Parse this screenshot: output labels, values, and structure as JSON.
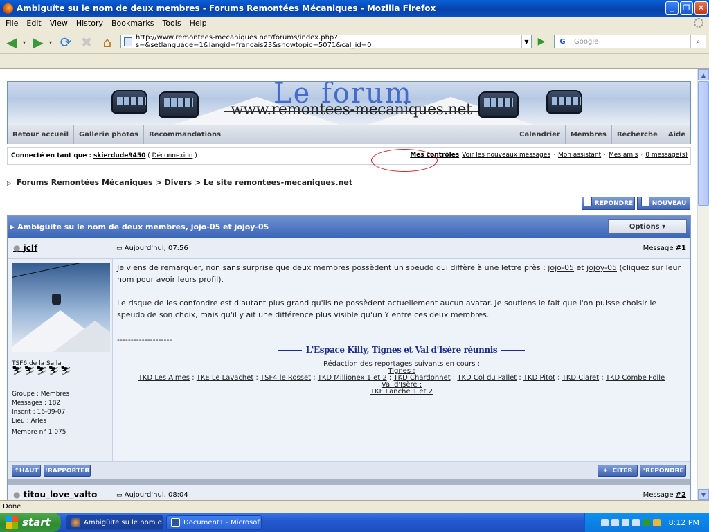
{
  "window": {
    "title": "Ambiguïte su le nom de deux membres - Forums Remontées Mécaniques - Mozilla Firefox"
  },
  "menu": [
    "File",
    "Edit",
    "View",
    "History",
    "Bookmarks",
    "Tools",
    "Help"
  ],
  "nav": {
    "url": "http://www.remontees-mecaniques.net/forums/index.php?s=&setlanguage=1&langid=francais23&showtopic=5071&cal_id=0",
    "search_engine": "G",
    "search_placeholder": "Google"
  },
  "banner": {
    "title": "Le forum",
    "site": "www.remontees-mecaniques.net"
  },
  "topnav": {
    "left": [
      "Retour accueil",
      "Gallerie photos",
      "Recommandations"
    ],
    "right": [
      "Calendrier",
      "Membres",
      "Recherche",
      "Aide"
    ]
  },
  "userbar": {
    "prefix": "Connecté en tant que :",
    "username": "skierdude9450",
    "logout": "Déconnexion",
    "links": [
      "Mes contrôles",
      "Voir les nouveaux messages",
      "Mon assistant",
      "Mes amis",
      "0 message(s)"
    ]
  },
  "breadcrumb": [
    "Forums Remontées Mécaniques",
    "Divers",
    "Le site remontees-mecaniques.net"
  ],
  "actions": {
    "reply": "REPONDRE",
    "new": "NOUVEAU"
  },
  "thread": {
    "title": "Ambigüite su le nom de deux membres, jojo-05 et jojoy-05",
    "options": "Options"
  },
  "post1": {
    "author": "jclf",
    "date": "Aujourd'hui, 07:56",
    "message_label": "Message",
    "message_num": "#1",
    "rank": "TSF6 de la Salla",
    "stats": [
      "Groupe : Membres",
      "Messages : 182",
      "Inscrit : 16-09-07",
      "Lieu : Arles",
      "Membre n° 1 075"
    ],
    "para1_a": "Je viens de remarquer, non sans surprise que deux membres possèdent un speudo qui diffère à une lettre près : ",
    "link1": "jojo-05",
    "para1_b": " et ",
    "link2": "jojoy-05",
    "para1_c": " (cliquez sur leur nom pour avoir leurs profil).",
    "para2": "Le risque de les confondre est d'autant plus grand qu'ils ne possèdent actuellement aucun avatar. Je soutiens le fait que l'on puisse choisir le speudo de son choix, mais qu'il y ait une différence plus visible qu'un Y entre ces deux membres.",
    "sig_dashes": "--------------------",
    "sig_title": "L'Espace Killy, Tignes et Val d'Isère réunnis",
    "sig_intro": "Rédaction des reportages suivants en cours :",
    "sig_tignes": "Tignes :",
    "sig_list": [
      "TKD Les Almes",
      "TKE Le Lavachet",
      "TSF4 le Rosset",
      "TKD Millionex 1 et 2",
      "TKD Chardonnet",
      "TKD Col du Pallet",
      "TKD Pitot",
      "TKD Claret",
      "TKD Combe Folle"
    ],
    "sig_val": "Val d'Isère :",
    "sig_val_list": "TKF Lanche 1 et 2",
    "btn_top": "HAUT",
    "btn_report": "RAPPORTER",
    "btn_quote": "CITER",
    "btn_reply": "REPONDRE"
  },
  "post2": {
    "author": "titou_love_valto",
    "date": "Aujourd'hui, 08:04",
    "message_label": "Message",
    "message_num": "#2"
  },
  "status": "Done",
  "taskbar": {
    "start": "start",
    "items": [
      "Ambigüite su le nom d...",
      "Document1 - Microsof..."
    ],
    "clock": "8:12 PM"
  }
}
